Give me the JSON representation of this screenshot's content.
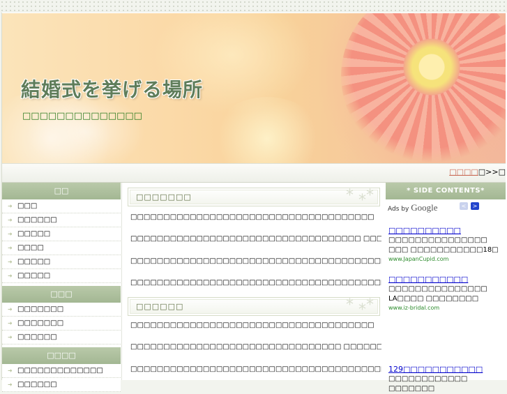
{
  "header": {
    "title": "結婚式を挙げる場所",
    "subtitle": "□□□□□□□□□□□□□□"
  },
  "nav": {
    "next_link": "□□□□",
    "next_arrow": "□>>□"
  },
  "left_sidebar": {
    "sections": [
      {
        "heading": "□□",
        "items": [
          "□□□",
          "□□□□□□",
          "□□□□□",
          "□□□□",
          "□□□□□",
          "□□□□□"
        ]
      },
      {
        "heading": "□□□",
        "items": [
          "□□□□□□□",
          "□□□□□□□",
          "□□□□□□"
        ]
      },
      {
        "heading": "□□□□",
        "items": [
          "□□□□□□□□□□□□□",
          "□□□□□□"
        ]
      }
    ]
  },
  "main": {
    "sections": [
      {
        "heading": "□□□□□□□",
        "paragraphs": [
          "□□□□□□□□□□□□□□□□□□□□□□□□□□□□□□□□□□□□□",
          "□□□□□□□□□□□□□□□□□□□□□□□□□□□□□□□□□□□ □□□□□□□□□□□□□□□□□□□□□□□□□",
          "□□□□□□□□□□□□□□□□□□□□□□□□□□□□□□□□□□□□□□□□□□□□□",
          "□□□□□□□□□□□□□□□□□□□□□□□□□□□□□□□□□□□□□□□□□□□□"
        ]
      },
      {
        "heading": "□□□□□□",
        "paragraphs": [
          "□□□□□□□□□□□□□□□□□□□□□□□□□□□□□□□□□□□□□",
          "□□□□□□□□□□□□□□□□□□□□□□□□□□□□□□□□ □□□□□□□□□□□□□□□□□□□□□□□□□",
          "□□□□□□□□□□□□□□□□□□□□□□□□□□□□□□□□□□□□□□□□□"
        ]
      }
    ],
    "stars": "* ⁎*"
  },
  "right_sidebar": {
    "heading": "* SIDE CONTENTS*",
    "ads_label": "Ads by",
    "ads_brand": "Google",
    "prev_arrow": "<",
    "next_arrow": ">",
    "ads": [
      {
        "title": "□□□□□□□□□□",
        "text": "□□□□□□□□□□□□□□□ □□□ □□□□□□□□□□□18□",
        "url": "www.JapanCupid.com"
      },
      {
        "title": "□□□□□□□□□□□",
        "text": "□□□□□□□□□□□□□□□ LA□□□□ □□□□□□□□",
        "url": "www.iz-bridal.com"
      },
      {
        "title": "129□□□□□□□□□□□",
        "text": "□□□□□□□□□□□□ □□□□□□□",
        "url": ""
      }
    ]
  },
  "colors": {
    "accent_green": "#a3b793",
    "title_green": "#5f7d5a",
    "link_blue": "#0000cc"
  }
}
